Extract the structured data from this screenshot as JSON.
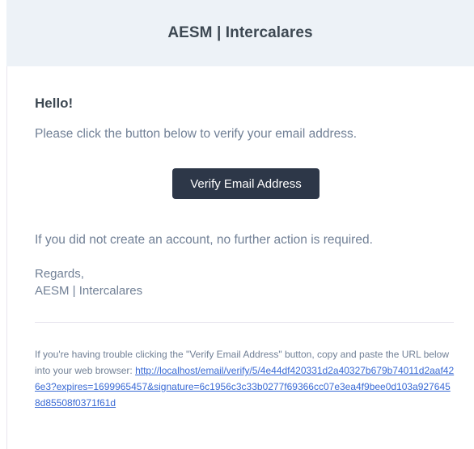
{
  "header": {
    "title": "AESM | Intercalares"
  },
  "email": {
    "greeting": "Hello!",
    "intro": "Please click the button below to verify your email address.",
    "button_label": "Verify Email Address",
    "no_action": "If you did not create an account, no further action is required.",
    "regards": "Regards,",
    "signature": "AESM | Intercalares"
  },
  "subcopy": {
    "text": "If you're having trouble clicking the \"Verify Email Address\" button, copy and paste the URL below into your web browser: ",
    "url": "http://localhost/email/verify/5/4e44df420331d2a40327b679b74011d2aaf426e3?expires=1699965457&signature=6c1956c3c33b0277f69366cc07e3ea4f9bee0d103a9276458d85508f0371f61d"
  },
  "colors": {
    "header_bg": "#edf2f7",
    "button_bg": "#2d3748",
    "link": "#3869d4",
    "marker": "#e3342f"
  }
}
